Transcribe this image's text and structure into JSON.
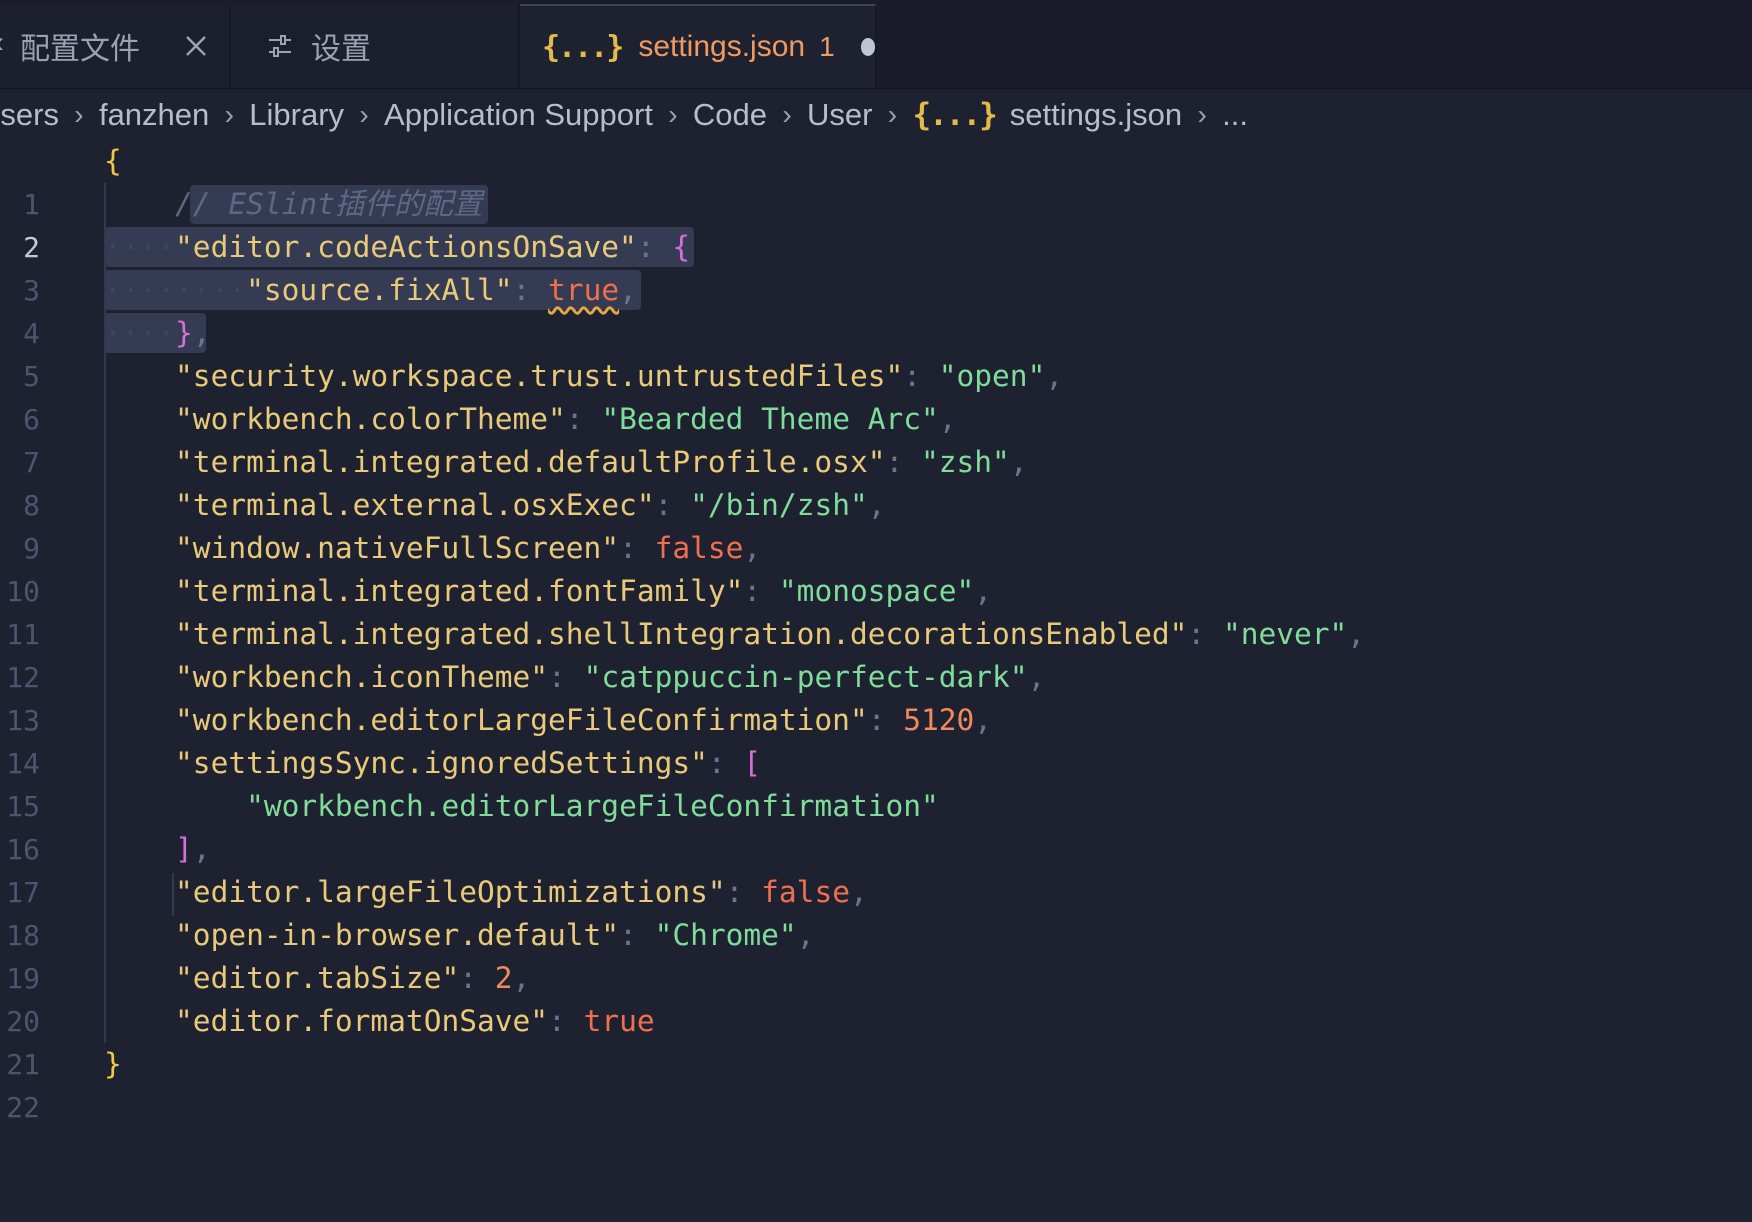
{
  "tabs": [
    {
      "label": "配置文件",
      "lead": "‹",
      "active": false
    },
    {
      "label": "设置",
      "active": false
    },
    {
      "label": "settings.json",
      "badge": "1",
      "icon": "{...}",
      "active": true,
      "dirty": true
    }
  ],
  "breadcrumb": [
    "Users",
    "fanzhen",
    "Library",
    "Application Support",
    "Code",
    "User",
    "settings.json",
    "..."
  ],
  "breadcrumb_json_icon": "{...}",
  "active_line": 2,
  "line_numbers": [
    "1",
    "2",
    "3",
    "4",
    "5",
    "6",
    "7",
    "8",
    "9",
    "10",
    "11",
    "12",
    "13",
    "14",
    "15",
    "16",
    "17",
    "18",
    "19",
    "20",
    "21",
    "22"
  ],
  "code": {
    "open_brace": "{",
    "comment": "// ESlint插件的配置",
    "l3_key": "\"editor.codeActionsOnSave\"",
    "l4_key": "\"source.fixAll\"",
    "l4_val": "true",
    "l6_key": "\"security.workspace.trust.untrustedFiles\"",
    "l6_val": "\"open\"",
    "l7_key": "\"workbench.colorTheme\"",
    "l7_val": "\"Bearded Theme Arc\"",
    "l8_key": "\"terminal.integrated.defaultProfile.osx\"",
    "l8_val": "\"zsh\"",
    "l9_key": "\"terminal.external.osxExec\"",
    "l9_val": "\"/bin/zsh\"",
    "l10_key": "\"window.nativeFullScreen\"",
    "l10_val": "false",
    "l11_key": "\"terminal.integrated.fontFamily\"",
    "l11_val": "\"monospace\"",
    "l12_key": "\"terminal.integrated.shellIntegration.decorationsEnabled\"",
    "l12_val": "\"never\"",
    "l13_key": "\"workbench.iconTheme\"",
    "l13_val": "\"catppuccin-perfect-dark\"",
    "l14_key": "\"workbench.editorLargeFileConfirmation\"",
    "l14_val": "5120",
    "l15_key": "\"settingsSync.ignoredSettings\"",
    "l16_val": "\"workbench.editorLargeFileConfirmation\"",
    "l18_key": "\"editor.largeFileOptimizations\"",
    "l18_val": "false",
    "l19_key": "\"open-in-browser.default\"",
    "l19_val": "\"Chrome\"",
    "l20_key": "\"editor.tabSize\"",
    "l20_val": "2",
    "l21_key": "\"editor.formatOnSave\"",
    "l21_val": "true",
    "close_brace": "}"
  },
  "colors": {
    "background": "#1e2230",
    "tab_active_text": "#ef9a5f",
    "key": "#e9c97a",
    "string": "#7fdc9a",
    "boolean": "#ef6f4e",
    "number": "#ef8a5c",
    "selection": "#343b52"
  },
  "icons": {
    "tab1_close": "close-icon",
    "tab2": "settings-sliders-icon",
    "tab3": "json-braces-icon",
    "dirty": "unsaved-dot-icon"
  }
}
